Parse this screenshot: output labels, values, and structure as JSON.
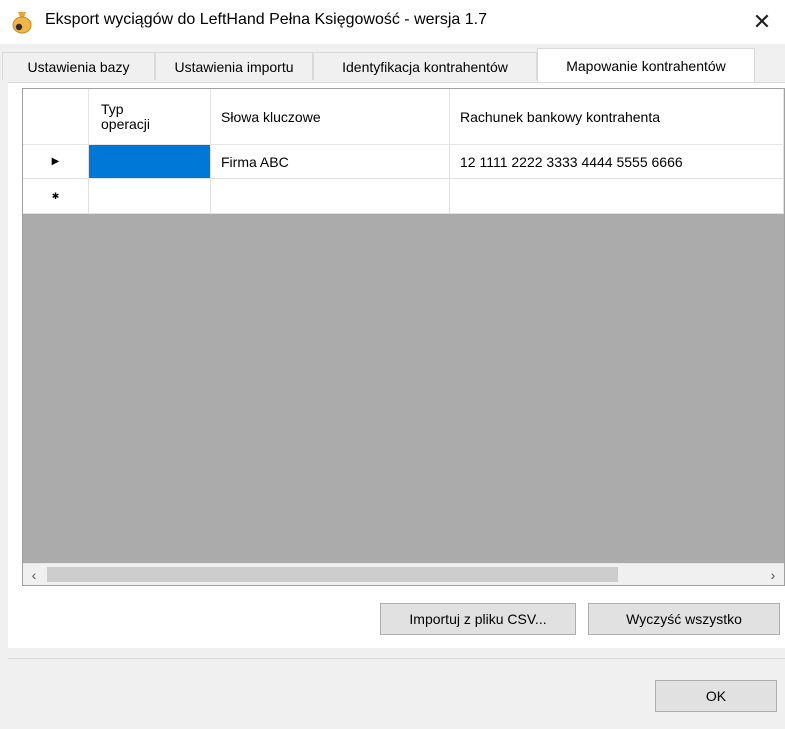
{
  "window": {
    "title": "Eksport wyciągów do LeftHand Pełna Księgowość - wersja 1.7",
    "close_symbol": "✕"
  },
  "tabs": [
    {
      "label": "Ustawienia bazy",
      "active": false
    },
    {
      "label": "Ustawienia importu",
      "active": false
    },
    {
      "label": "Identyfikacja kontrahentów",
      "active": false
    },
    {
      "label": "Mapowanie kontrahentów",
      "active": true
    }
  ],
  "grid": {
    "columns": [
      {
        "line1": "Typ",
        "line2": "operacji"
      },
      {
        "label": "Słowa kluczowe"
      },
      {
        "label": "Rachunek bankowy kontrahenta"
      }
    ],
    "rows": [
      {
        "marker": "▶",
        "typ_operacji": "",
        "slowa_kluczowe": "Firma ABC",
        "rachunek": "12 1111 2222 3333 4444 5555 6666"
      },
      {
        "marker": "✱",
        "typ_operacji": "",
        "slowa_kluczowe": "",
        "rachunek": ""
      }
    ],
    "scroll": {
      "left_arrow": "‹",
      "right_arrow": "›"
    }
  },
  "buttons": {
    "import": "Importuj z pliku CSV...",
    "clear": "Wyczyść wszystko",
    "ok": "OK"
  },
  "colors": {
    "selection": "#0078d7",
    "grid_empty_area": "#ababab"
  },
  "icons": {
    "app": "money-bag-icon",
    "close": "close-icon",
    "current_row": "current-row-arrow-icon",
    "new_row": "new-row-asterisk-icon"
  }
}
